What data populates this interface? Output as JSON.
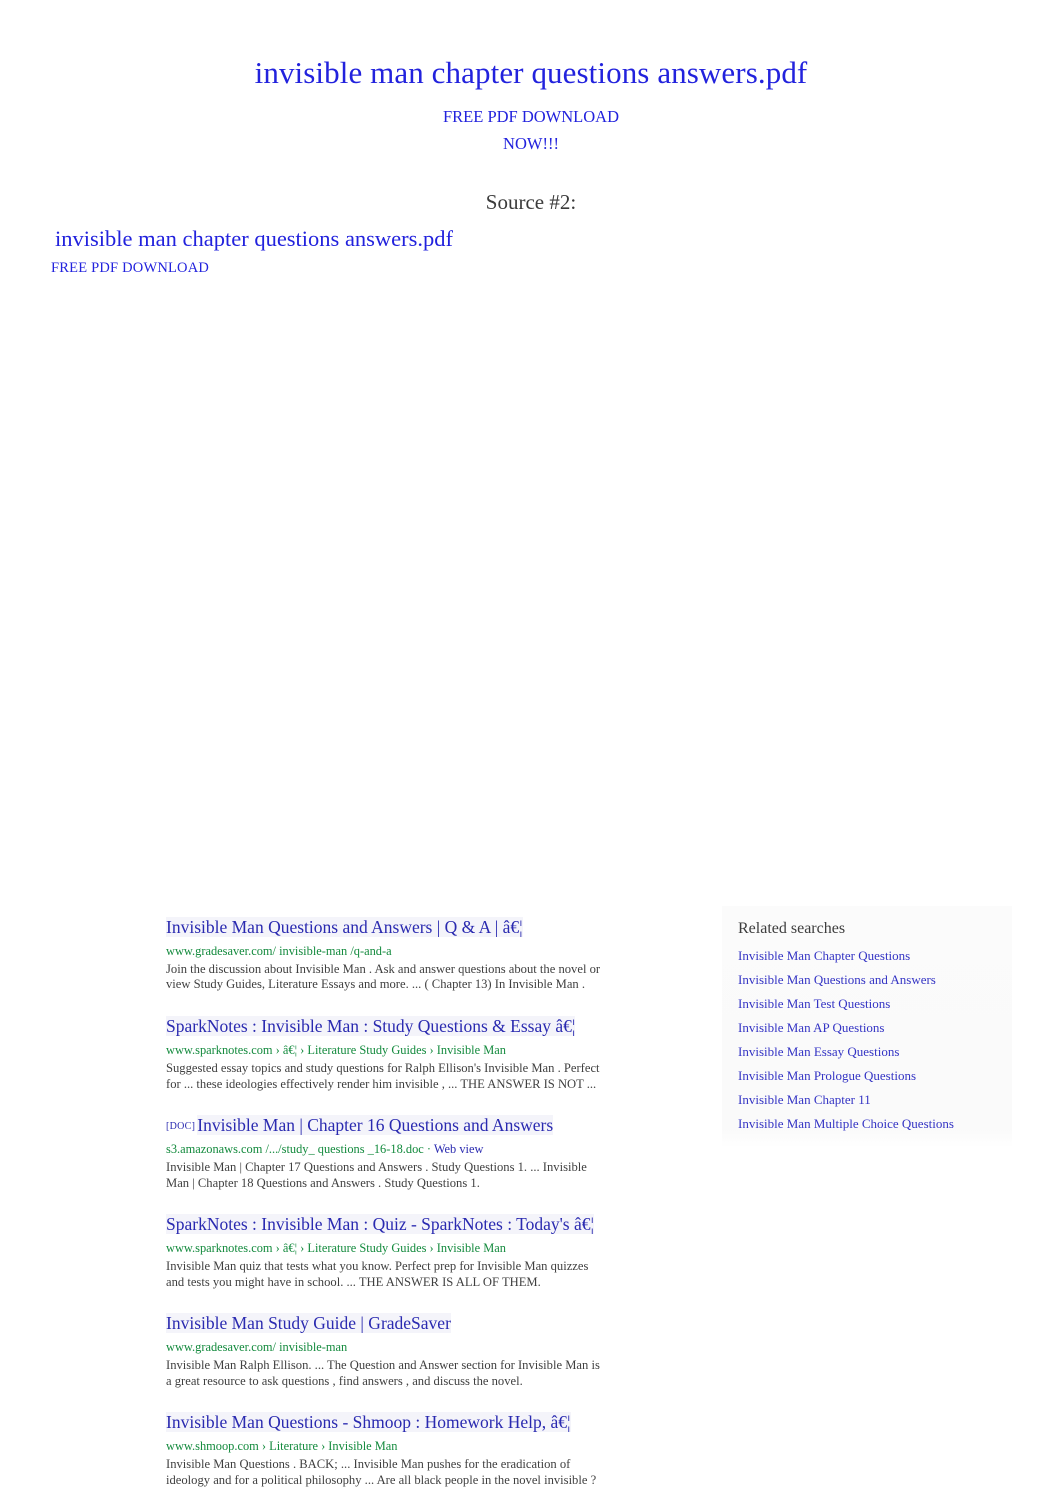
{
  "header": {
    "title": "invisible man chapter questions answers.pdf",
    "sub_line1": "FREE PDF DOWNLOAD",
    "sub_line2": "NOW!!!",
    "source_label": "Source #2:",
    "second_title": "invisible man chapter questions answers.pdf",
    "second_sub": "FREE PDF DOWNLOAD"
  },
  "colors": {
    "header_blue": "#2222dd",
    "link_blue": "#2a2ab0",
    "url_green": "#138a3d",
    "snippet_gray": "#3f3f3f",
    "related_blue": "#3434c4",
    "panel_bg": "#fafafa"
  },
  "results": [
    {
      "doc_tag": "",
      "title": "Invisible Man    Questions     and  Answers   | Q & A | â€¦",
      "url": "www.gradesaver.com/    invisible-man   /q-and-a",
      "url_extra": "",
      "snippet": "Join the discussion about     Invisible Man  . Ask and  answer   questions    about the novel or\nview Study Guides, Literature Essays and more. ... (       Chapter    13) In  Invisible Man  ."
    },
    {
      "doc_tag": "",
      "title": "SparkNotes   : Invisible Man  : Study  Questions    & Essay â€¦",
      "url": "www.sparknotes.com      › â€¦ › Literature Study Guides ›     Invisible Man",
      "url_extra": "",
      "snippet": "Suggested essay topics and study        questions    for Ralph Ellison's  Invisible Man  . Perfect\nfor ... these ideologies effectively render him      invisible  , ... THE  ANSWER  IS NOT ..."
    },
    {
      "doc_tag": "[DOC]",
      "title": "Invisible Man    | Chapter   16 Questions    and  Answers",
      "url": "s3.amazonaws.com     /.../study_  questions   _16-18.doc  · ",
      "url_extra": "Web view",
      "snippet": "Invisible Man   | Chapter   17 Questions    and  Answers  . Study  Questions    1. ...  Invisible\nMan | Chapter   18 Questions    and  Answers  . Study  Questions    1."
    },
    {
      "doc_tag": "",
      "title": "SparkNotes   : Invisible Man  : Quiz  - SparkNotes   : Today's â€¦",
      "url": "www.sparknotes.com      › â€¦ › Literature Study Guides ›     Invisible Man",
      "url_extra": "",
      "snippet": "Invisible Man   quiz  that tests what you know. Perfect prep for      Invisible Man   quizzes\nand tests you might have in school. ... THE      ANSWER  IS ALL OF THEM."
    },
    {
      "doc_tag": "",
      "title": "Invisible Man    Study Guide | GradeSaver",
      "url": "www.gradesaver.com/    invisible-man",
      "url_extra": "",
      "snippet": "Invisible Man    Ralph Ellison. ... The   Question   and  Answer   section for  Invisible Man    is\na great resource to ask     questions   , find answers   , and discuss the novel."
    },
    {
      "doc_tag": "",
      "title": "Invisible Man    Questions    - Shmoop  : Homework Help, â€¦",
      "url": "www.shmoop.com      › Literature ›  Invisible Man",
      "url_extra": "",
      "snippet": "Invisible Man   Questions   . BACK; ...  Invisible Man    pushes for the eradication of\nideology and for a political philosophy ... Are all black people in the novel        invisible  ?"
    }
  ],
  "related": {
    "heading": "Related searches",
    "items": [
      "Invisible   Man  Chapter    Questions",
      "Invisible   Man  Questions     and  Answers",
      "Invisible   Man  Test  Questions",
      "Invisible   Man  AP  Questions",
      "Invisible   Man  Essay   Questions",
      "Invisible   Man  Prologue   Questions",
      "Invisible   Man  Chapter    11",
      "Invisible   Man  Multiple Choice  Questions"
    ]
  }
}
